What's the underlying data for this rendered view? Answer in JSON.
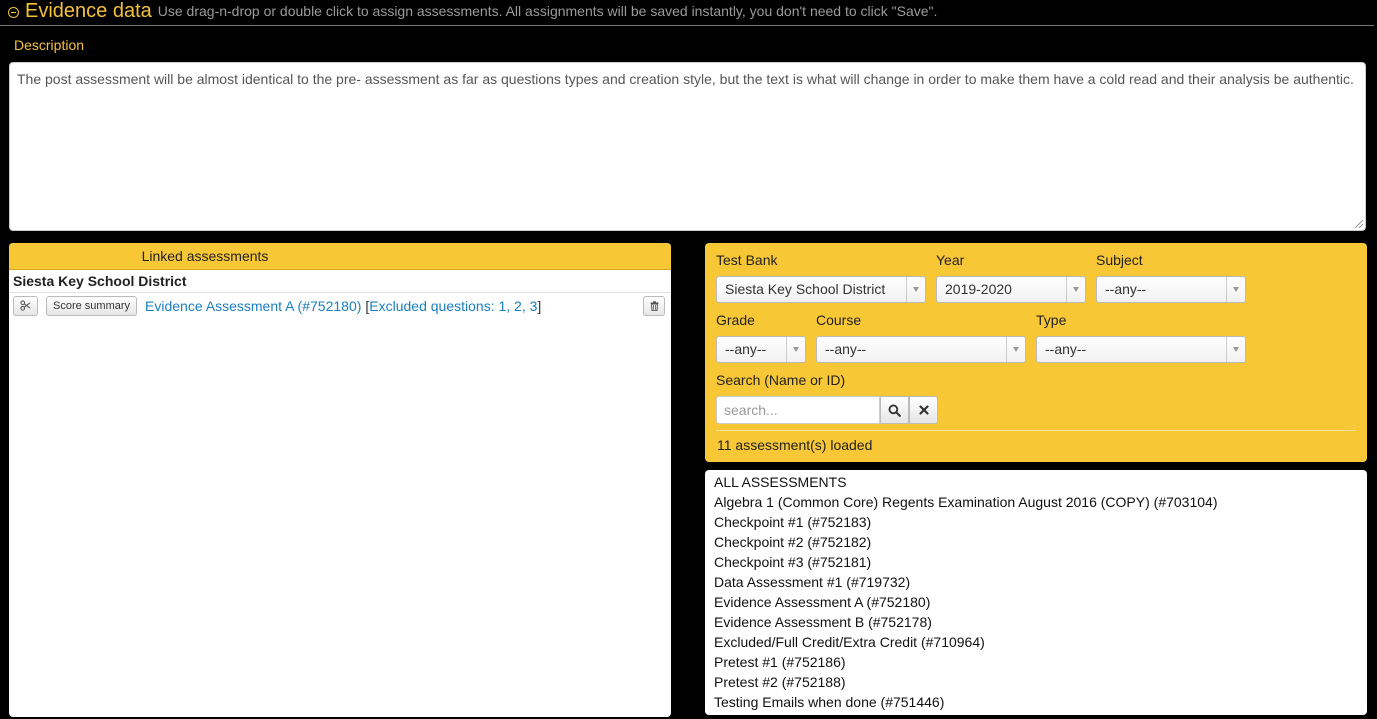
{
  "header": {
    "title": "Evidence data",
    "subtitle": "Use drag-n-drop or double click to assign assessments. All assignments will be saved instantly, you don't need to click \"Save\"."
  },
  "description": {
    "label": "Description",
    "text": "The post assessment will be almost identical to the pre- assessment as far as questions types and creation style, but the text is what will change in order to make them have a cold read and their analysis be authentic."
  },
  "linked": {
    "header": "Linked assessments",
    "district": "Siesta Key School District",
    "items": [
      {
        "score_button": "Score summary",
        "name": "Evidence Assessment A (#752180)",
        "bracket_open": "[",
        "excluded": "Excluded questions: 1, 2, 3",
        "bracket_close": "]"
      }
    ]
  },
  "filters": {
    "test_bank": {
      "label": "Test Bank",
      "value": "Siesta Key School District"
    },
    "year": {
      "label": "Year",
      "value": "2019-2020"
    },
    "subject": {
      "label": "Subject",
      "value": "--any--"
    },
    "grade": {
      "label": "Grade",
      "value": "--any--"
    },
    "course": {
      "label": "Course",
      "value": "--any--"
    },
    "type": {
      "label": "Type",
      "value": "--any--"
    },
    "search": {
      "label": "Search (Name or ID)",
      "placeholder": "search...",
      "value": ""
    },
    "loaded_text": "11 assessment(s) loaded"
  },
  "assessments": [
    "ALL ASSESSMENTS",
    "Algebra 1 (Common Core) Regents Examination August 2016 (COPY) (#703104)",
    "Checkpoint #1 (#752183)",
    "Checkpoint #2 (#752182)",
    "Checkpoint #3 (#752181)",
    "Data Assessment #1 (#719732)",
    "Evidence Assessment A (#752180)",
    "Evidence Assessment B (#752178)",
    "Excluded/Full Credit/Extra Credit (#710964)",
    "Pretest #1 (#752186)",
    "Pretest #2 (#752188)",
    "Testing Emails when done (#751446)"
  ],
  "colors": {
    "accent": "#f5c13a",
    "panel": "#f8c735",
    "link": "#1a7fc1",
    "background": "#000000"
  }
}
